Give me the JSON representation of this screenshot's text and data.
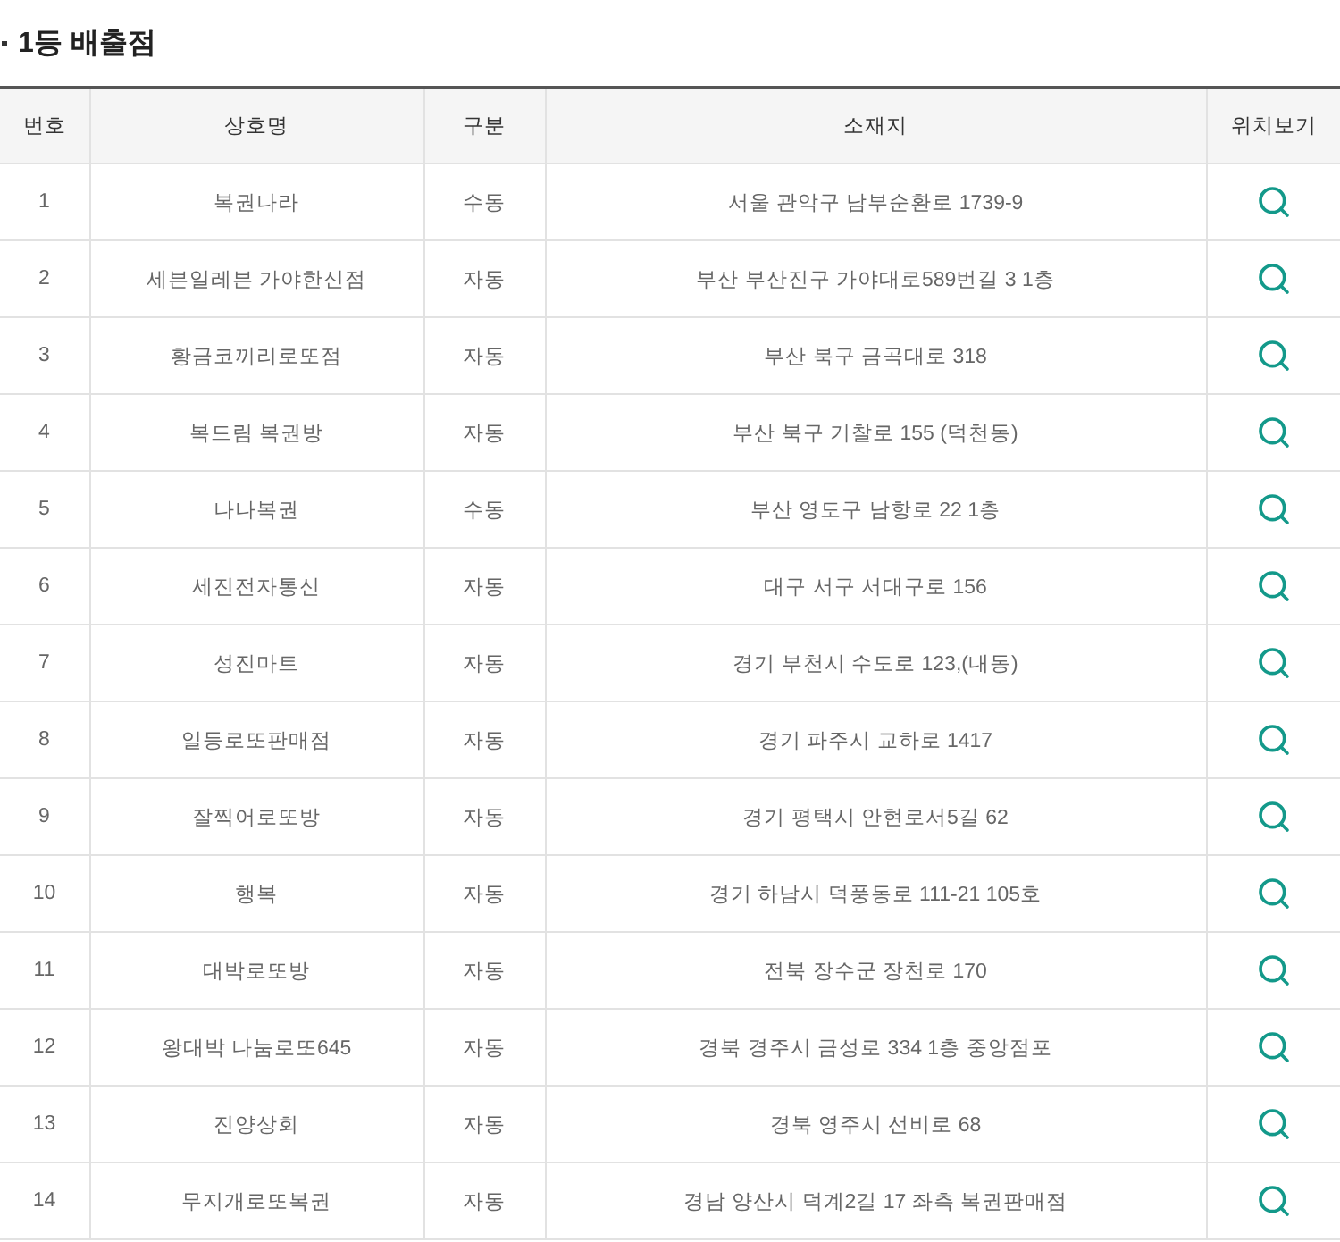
{
  "title": "1등 배출점",
  "table": {
    "columns": [
      "번호",
      "상호명",
      "구분",
      "소재지",
      "위치보기"
    ],
    "rows": [
      {
        "no": "1",
        "name": "복권나라",
        "type": "수동",
        "address": "서울 관악구 남부순환로 1739-9"
      },
      {
        "no": "2",
        "name": "세븐일레븐 가야한신점",
        "type": "자동",
        "address": "부산 부산진구 가야대로589번길 3 1층"
      },
      {
        "no": "3",
        "name": "황금코끼리로또점",
        "type": "자동",
        "address": "부산 북구 금곡대로 318"
      },
      {
        "no": "4",
        "name": "복드림 복권방",
        "type": "자동",
        "address": "부산 북구 기찰로 155 (덕천동)"
      },
      {
        "no": "5",
        "name": "나나복권",
        "type": "수동",
        "address": "부산 영도구 남항로 22 1층"
      },
      {
        "no": "6",
        "name": "세진전자통신",
        "type": "자동",
        "address": "대구 서구 서대구로 156"
      },
      {
        "no": "7",
        "name": "성진마트",
        "type": "자동",
        "address": "경기 부천시 수도로 123,(내동)"
      },
      {
        "no": "8",
        "name": "일등로또판매점",
        "type": "자동",
        "address": "경기 파주시 교하로 1417"
      },
      {
        "no": "9",
        "name": "잘찍어로또방",
        "type": "자동",
        "address": "경기 평택시 안현로서5길 62"
      },
      {
        "no": "10",
        "name": "행복",
        "type": "자동",
        "address": "경기 하남시 덕풍동로 111-21 105호"
      },
      {
        "no": "11",
        "name": "대박로또방",
        "type": "자동",
        "address": "전북 장수군 장천로 170"
      },
      {
        "no": "12",
        "name": "왕대박 나눔로또645",
        "type": "자동",
        "address": "경북 경주시 금성로 334 1층 중앙점포"
      },
      {
        "no": "13",
        "name": "진양상회",
        "type": "자동",
        "address": "경북 영주시 선비로 68"
      },
      {
        "no": "14",
        "name": "무지개로또복권",
        "type": "자동",
        "address": "경남 양산시 덕계2길 17 좌측 복권판매점"
      }
    ]
  }
}
